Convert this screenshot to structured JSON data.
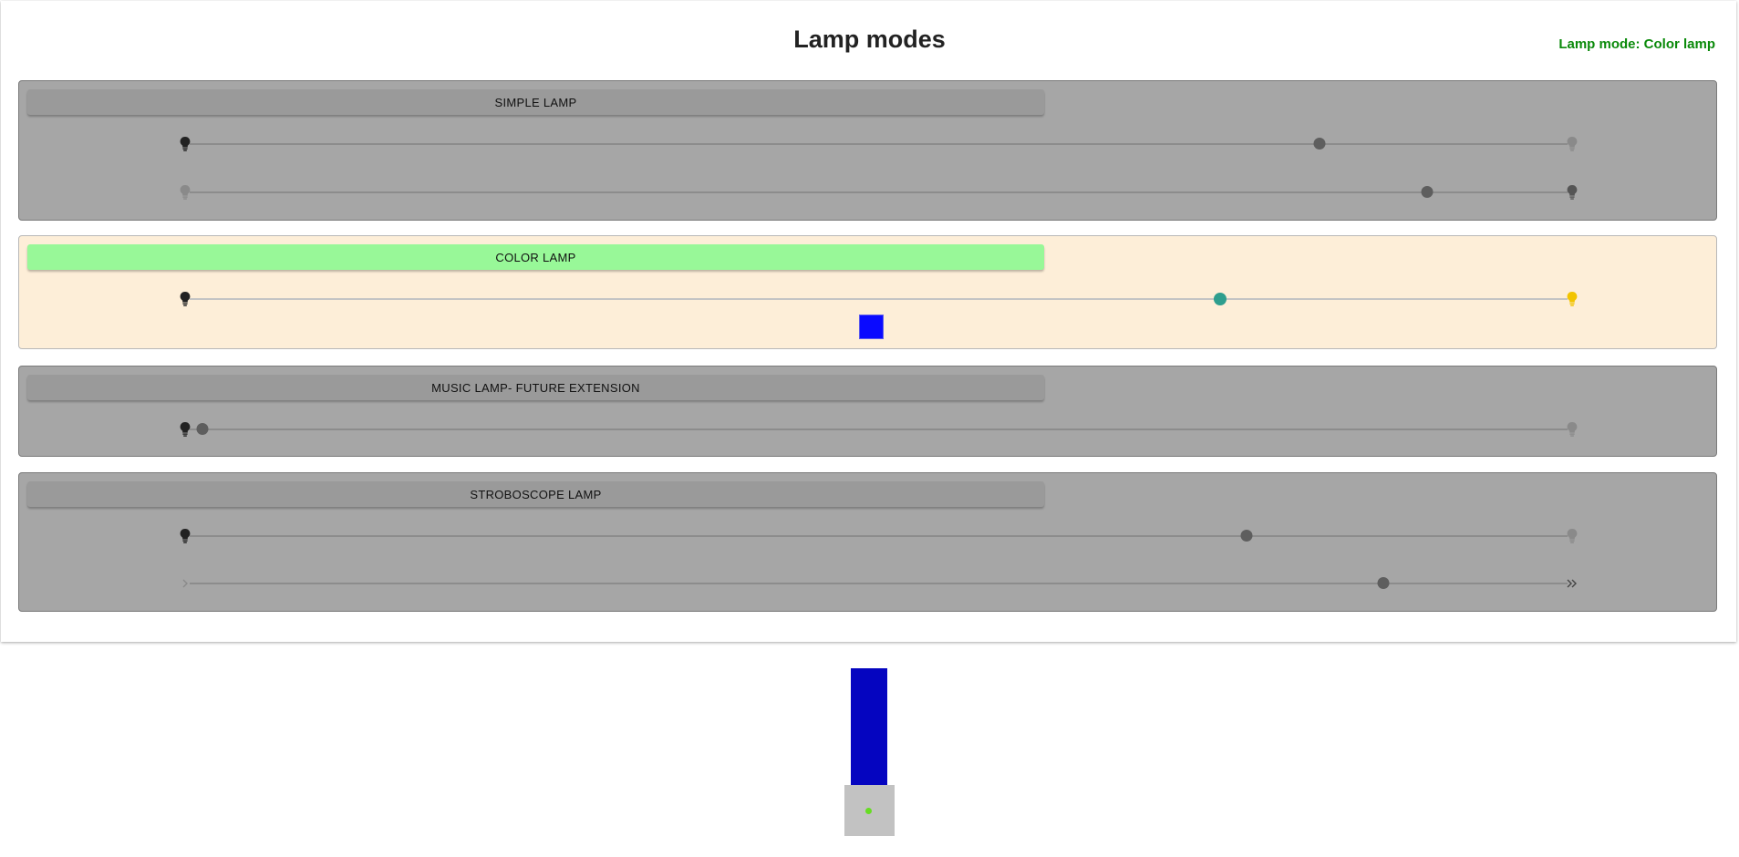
{
  "header": {
    "title": "Lamp modes",
    "status": "Lamp mode: Color lamp"
  },
  "modes": {
    "simple": {
      "label": "SIMPLE LAMP",
      "brightness": 0.82,
      "second_slider": 0.898
    },
    "color": {
      "label": "COLOR LAMP",
      "brightness": 0.748,
      "color": "#0a0aff",
      "active": true
    },
    "music": {
      "label": "MUSIC LAMP- FUTURE EXTENSION",
      "brightness": 0.009
    },
    "strobe": {
      "label": "STROBOSCOPE LAMP",
      "brightness": 0.767,
      "speed": 0.866
    }
  },
  "lamp_preview": {
    "shade_color": "#0505c0",
    "led_color": "#66dd22"
  },
  "icons": {
    "brightness_low": "bulb-off-icon",
    "brightness_high": "bulb-on-icon",
    "speed_slow": "chevron-right-icon",
    "speed_fast": "double-chevron-right-icon"
  }
}
